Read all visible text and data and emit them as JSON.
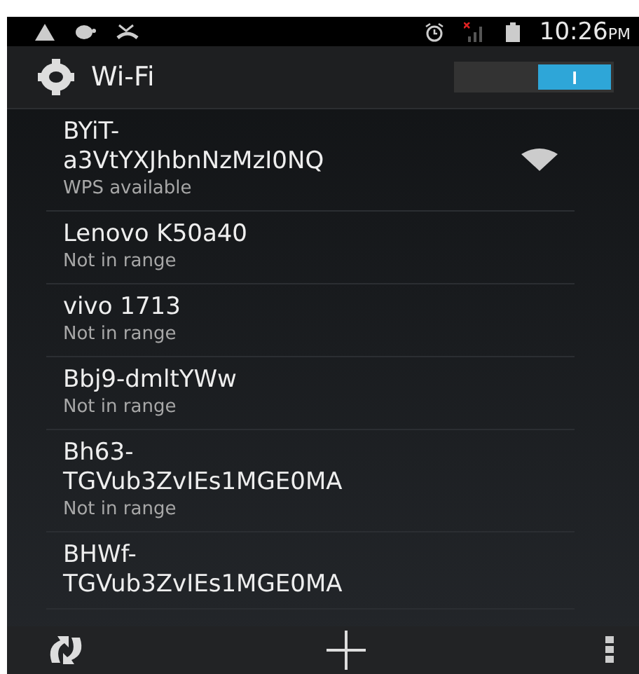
{
  "status_bar": {
    "time": "10:26",
    "period": "PM"
  },
  "action_bar": {
    "title": "Wi-Fi",
    "switch": {
      "on": true,
      "label": "I"
    }
  },
  "networks": [
    {
      "name": "BYiT-\na3VtYXJhbnNzMzI0NQ",
      "status": "WPS available",
      "signal": true
    },
    {
      "name": "Lenovo K50a40",
      "status": "Not in range",
      "signal": false
    },
    {
      "name": "vivo 1713",
      "status": "Not in range",
      "signal": false
    },
    {
      "name": "Bbj9-dmltYWw",
      "status": "Not in range",
      "signal": false
    },
    {
      "name": "Bh63-\nTGVub3ZvIEs1MGE0MA",
      "status": "Not in range",
      "signal": false
    },
    {
      "name": "BHWf-\nTGVub3ZvIEs1MGE0MA",
      "signal": false
    }
  ]
}
